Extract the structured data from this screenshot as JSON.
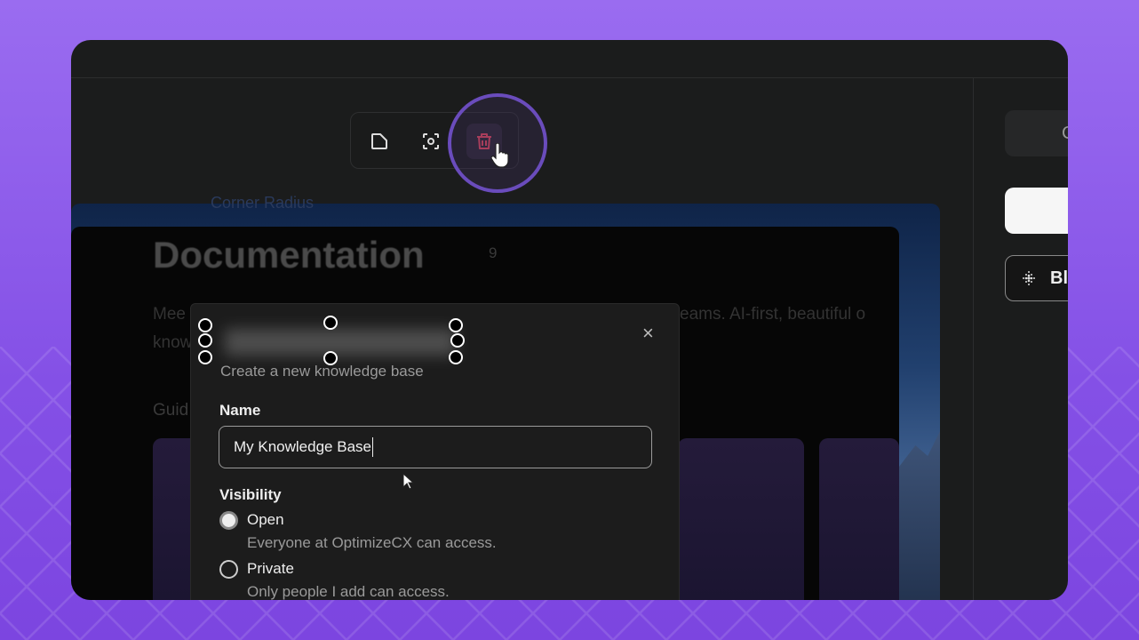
{
  "canvas": {
    "corner_radius_label": "Corner Radius",
    "page_title": "Documentation",
    "corner_radius_value": "9",
    "intro_left_1": "Mee",
    "intro_right_1": "eams. AI-first, beautiful o",
    "intro_left_2": "know",
    "guides_label": "Guid"
  },
  "toolbar": {
    "items": [
      {
        "icon": "corner-radius-icon"
      },
      {
        "icon": "focus-icon"
      },
      {
        "icon": "trash-icon",
        "color": "#e0455c"
      }
    ]
  },
  "dialog": {
    "subtitle": "Create a new knowledge base",
    "close_label": "×",
    "name_label": "Name",
    "name_value": "My Knowledge Base",
    "visibility_label": "Visibility",
    "options": [
      {
        "label": "Open",
        "description": "Everyone at OptimizeCX can access.",
        "selected": true
      },
      {
        "label": "Private",
        "description": "Only people I add can access.",
        "selected": false
      }
    ]
  },
  "right_panel": {
    "button_1_label": "C",
    "blur_label": "Bl"
  },
  "colors": {
    "accent": "#6a4cbc",
    "danger": "#e0455c",
    "background": "#8a55e8"
  }
}
